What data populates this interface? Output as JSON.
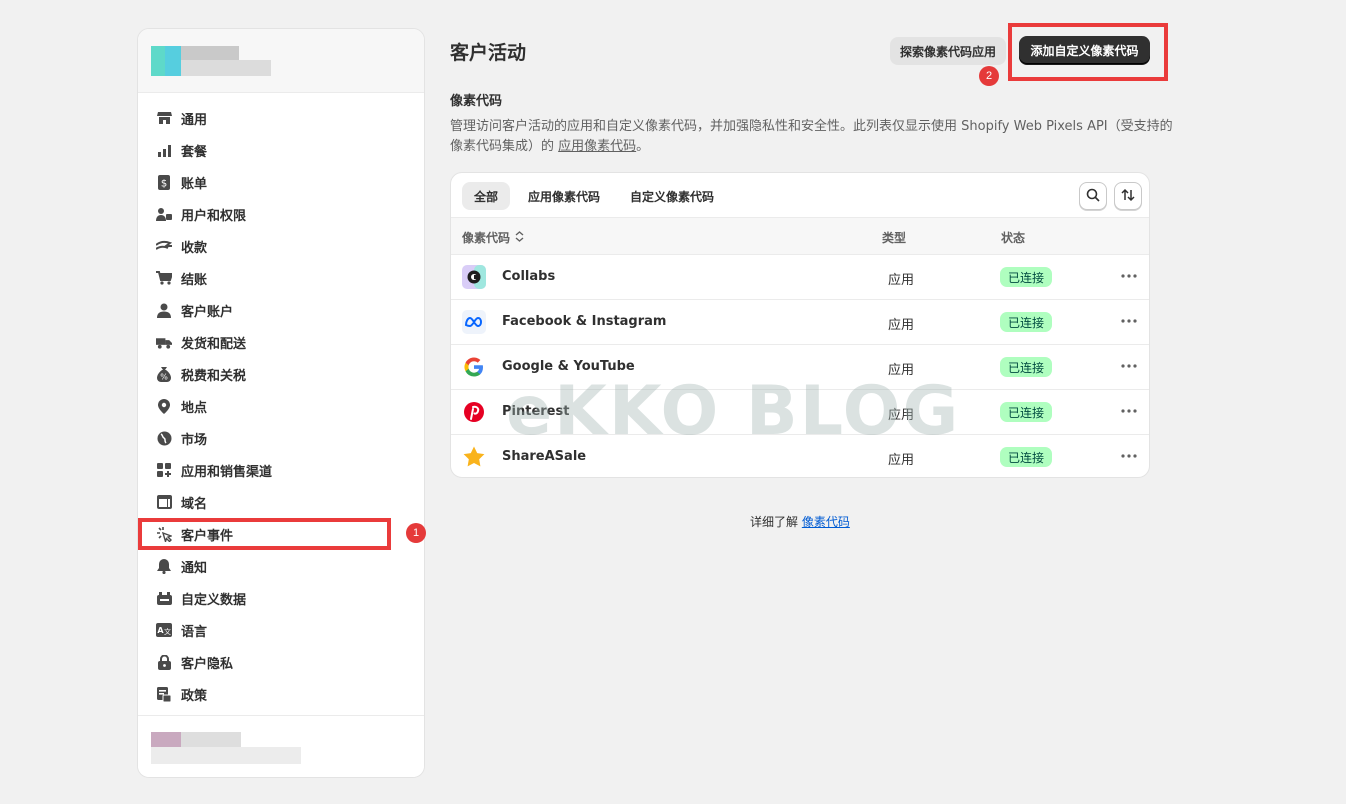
{
  "sidebar": {
    "items": [
      {
        "label": "通用",
        "icon": "store-icon"
      },
      {
        "label": "套餐",
        "icon": "plan-chart-icon"
      },
      {
        "label": "账单",
        "icon": "billing-icon"
      },
      {
        "label": "用户和权限",
        "icon": "users-icon"
      },
      {
        "label": "收款",
        "icon": "payments-icon"
      },
      {
        "label": "结账",
        "icon": "cart-icon"
      },
      {
        "label": "客户账户",
        "icon": "person-icon"
      },
      {
        "label": "发货和配送",
        "icon": "truck-icon"
      },
      {
        "label": "税费和关税",
        "icon": "tax-bag-icon"
      },
      {
        "label": "地点",
        "icon": "location-pin-icon"
      },
      {
        "label": "市场",
        "icon": "globe-icon"
      },
      {
        "label": "应用和销售渠道",
        "icon": "apps-icon"
      },
      {
        "label": "域名",
        "icon": "domain-icon"
      },
      {
        "label": "客户事件",
        "icon": "cursor-click-icon"
      },
      {
        "label": "通知",
        "icon": "bell-icon"
      },
      {
        "label": "自定义数据",
        "icon": "metafields-icon"
      },
      {
        "label": "语言",
        "icon": "language-icon"
      },
      {
        "label": "客户隐私",
        "icon": "lock-icon"
      },
      {
        "label": "政策",
        "icon": "policy-icon"
      }
    ]
  },
  "header": {
    "title": "客户活动",
    "explore_button": "探索像素代码应用",
    "add_button": "添加自定义像素代码"
  },
  "section": {
    "title": "像素代码",
    "desc_prefix": "管理访问客户活动的应用和自定义像素代码，并加强隐私性和安全性。此列表仅显示使用 Shopify Web Pixels API（受支持的像素代码集成）的 ",
    "desc_link": "应用像素代码",
    "desc_suffix": "。"
  },
  "tabs": [
    "全部",
    "应用像素代码",
    "自定义像素代码"
  ],
  "table": {
    "headers": {
      "pixel": "像素代码",
      "type": "类型",
      "status": "状态"
    },
    "rows": [
      {
        "name": "Collabs",
        "type": "应用",
        "status": "已连接",
        "icon": "collabs-icon"
      },
      {
        "name": "Facebook & Instagram",
        "type": "应用",
        "status": "已连接",
        "icon": "meta-icon"
      },
      {
        "name": "Google & YouTube",
        "type": "应用",
        "status": "已连接",
        "icon": "google-icon"
      },
      {
        "name": "Pinterest",
        "type": "应用",
        "status": "已连接",
        "icon": "pinterest-icon"
      },
      {
        "name": "ShareASale",
        "type": "应用",
        "status": "已连接",
        "icon": "star-icon"
      }
    ]
  },
  "footer": {
    "learn_prefix": "详细了解 ",
    "learn_link": "像素代码"
  },
  "annotations": {
    "badge1": "1",
    "badge2": "2"
  },
  "watermark": "eKKO BLOG",
  "colors": {
    "primary_button": "#303030",
    "status_bg": "#affebf",
    "annotation": "#ea3b3b",
    "link": "#005bd3"
  }
}
